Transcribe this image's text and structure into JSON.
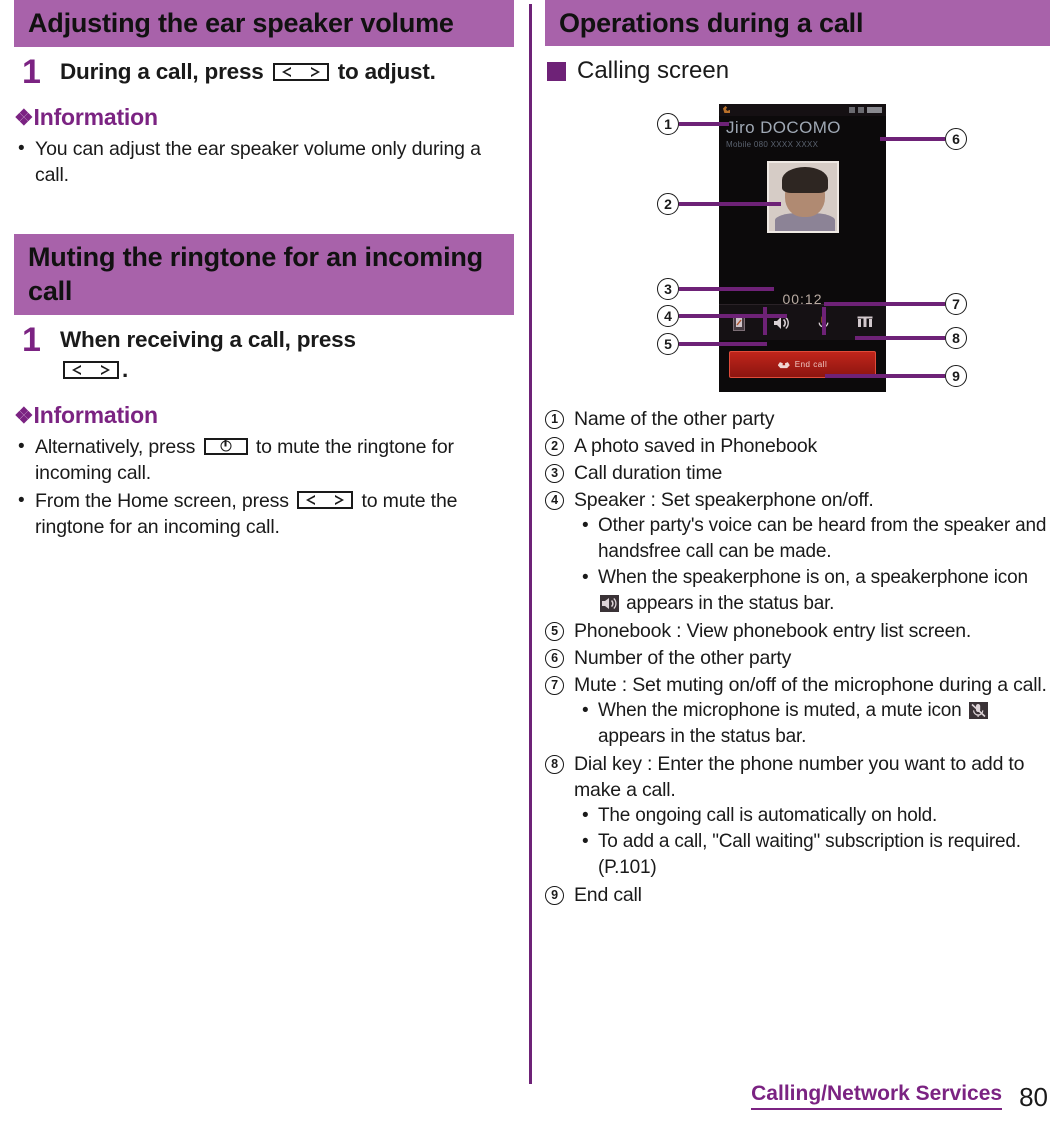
{
  "colors": {
    "header_bar": "#A862AA",
    "accent_purple": "#7B2382",
    "dark_purple": "#6E2277",
    "divider": "#6E2277"
  },
  "left_column": {
    "section1": {
      "heading": "Adjusting the ear speaker volume",
      "step": {
        "number": "1",
        "text_before": "During a call, press",
        "key_icon": "volume-key-icon",
        "text_after": "to adjust."
      },
      "information": {
        "heading": "Information",
        "notes": [
          "You can adjust the ear speaker volume only during a call."
        ]
      }
    },
    "section2": {
      "heading": "Muting the ringtone for an incoming call",
      "step": {
        "number": "1",
        "text_before": "When receiving a call, press",
        "key_icon": "volume-key-icon",
        "text_after": "."
      },
      "information": {
        "heading": "Information",
        "notes": [
          {
            "text_before": "Alternatively, press",
            "key_icon": "power-key-icon",
            "text_after": "to mute the ringtone for incoming call."
          },
          {
            "text_before": "From the Home screen, press",
            "key_icon": "volume-key-icon",
            "text_after": "to mute the ringtone for an incoming call."
          }
        ]
      }
    }
  },
  "right_column": {
    "heading": "Operations during a call",
    "sub_heading": "Calling screen",
    "phone_screen": {
      "contact_name": "Jiro DOCOMO",
      "contact_number": "Mobile 080 XXXX XXXX",
      "call_timer": "00:12",
      "end_call_label": "End call",
      "keys": [
        "phonebook-icon",
        "speaker-icon",
        "mute-icon",
        "dial-key-icon"
      ]
    },
    "callouts": [
      {
        "n": "1",
        "side": "left"
      },
      {
        "n": "2",
        "side": "left"
      },
      {
        "n": "3",
        "side": "left"
      },
      {
        "n": "4",
        "side": "left"
      },
      {
        "n": "5",
        "side": "left"
      },
      {
        "n": "6",
        "side": "right"
      },
      {
        "n": "7",
        "side": "right"
      },
      {
        "n": "8",
        "side": "right"
      },
      {
        "n": "9",
        "side": "right"
      }
    ],
    "legend": [
      {
        "n": "1",
        "text": "Name of the other party",
        "sub": []
      },
      {
        "n": "2",
        "text": "A photo saved in Phonebook",
        "sub": []
      },
      {
        "n": "3",
        "text": "Call duration time",
        "sub": []
      },
      {
        "n": "4",
        "text": "Speaker : Set speakerphone on/off.",
        "sub": [
          {
            "text": "Other party's voice can be heard from the speaker and handsfree call can be made."
          },
          {
            "text_before": "When the speakerphone is on, a speakerphone icon",
            "icon": "speakerphone-status-icon",
            "text_after": "appears in the status bar."
          }
        ]
      },
      {
        "n": "5",
        "text": "Phonebook : View phonebook entry list screen.",
        "sub": []
      },
      {
        "n": "6",
        "text": "Number of the other party",
        "sub": []
      },
      {
        "n": "7",
        "text": "Mute : Set muting on/off of the microphone during a call.",
        "sub": [
          {
            "text_before": "When the microphone is muted, a mute icon",
            "icon": "mute-status-icon",
            "text_after": "appears in the status bar."
          }
        ]
      },
      {
        "n": "8",
        "text": "Dial key : Enter the phone number you want to add to make a call.",
        "sub": [
          {
            "text": "The ongoing call is automatically on hold."
          },
          {
            "text": "To add a call, \"Call waiting\" subscription is required. (P.101)"
          }
        ]
      },
      {
        "n": "9",
        "text": "End call",
        "sub": []
      }
    ]
  },
  "footer": {
    "section_name": "Calling/Network Services",
    "page_number": "80"
  }
}
